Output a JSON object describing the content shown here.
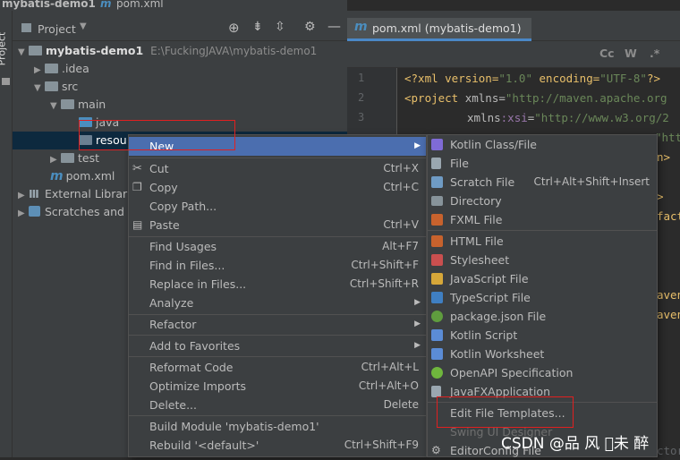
{
  "window": {
    "title": "mybatis-demo1",
    "file_title": "pom.xml"
  },
  "side_strip": {
    "label": "Project"
  },
  "project_panel": {
    "title": "Project",
    "root": {
      "name": "mybatis-demo1",
      "path": "E:\\FuckingJAVA\\mybatis-demo1"
    },
    "items": [
      {
        "label": ".idea"
      },
      {
        "label": "src"
      },
      {
        "label": "main"
      },
      {
        "label": "java"
      },
      {
        "label": "resou"
      },
      {
        "label": "test"
      },
      {
        "label": "pom.xml"
      },
      {
        "label": "External Librar"
      },
      {
        "label": "Scratches and"
      }
    ]
  },
  "editor": {
    "tab_label": "pom.xml (mybatis-demo1)",
    "line_numbers": [
      "1",
      "2",
      "3"
    ],
    "lines": [
      {
        "t1": "<?xml version=",
        "t2": "\"1.0\"",
        "t3": " encoding=",
        "t4": "\"UTF-8\"",
        "t5": "?>"
      },
      {
        "t1": "<project ",
        "t2": "xmlns",
        "t3": "=",
        "t4": "\"http://maven.apache.org"
      },
      {
        "t1": "xmlns",
        "t2": ":xsi",
        "t3": "=",
        "t4": "\"http://www.w3.org/2"
      }
    ],
    "fragments": [
      "n>",
      ">",
      "fact",
      "aven",
      "aven",
      "ctor"
    ],
    "toolbar": [
      "Cc",
      "W",
      ".*"
    ]
  },
  "context_menu": {
    "items": [
      {
        "label": "New",
        "shortcut": ""
      },
      {
        "label": "Cut",
        "shortcut": "Ctrl+X"
      },
      {
        "label": "Copy",
        "shortcut": "Ctrl+C"
      },
      {
        "label": "Copy Path...",
        "shortcut": ""
      },
      {
        "label": "Paste",
        "shortcut": "Ctrl+V"
      },
      {
        "label": "Find Usages",
        "shortcut": "Alt+F7"
      },
      {
        "label": "Find in Files...",
        "shortcut": "Ctrl+Shift+F"
      },
      {
        "label": "Replace in Files...",
        "shortcut": "Ctrl+Shift+R"
      },
      {
        "label": "Analyze",
        "shortcut": ""
      },
      {
        "label": "Refactor",
        "shortcut": ""
      },
      {
        "label": "Add to Favorites",
        "shortcut": ""
      },
      {
        "label": "Reformat Code",
        "shortcut": "Ctrl+Alt+L"
      },
      {
        "label": "Optimize Imports",
        "shortcut": "Ctrl+Alt+O"
      },
      {
        "label": "Delete...",
        "shortcut": "Delete"
      },
      {
        "label": "Build Module 'mybatis-demo1'",
        "shortcut": ""
      },
      {
        "label": "Rebuild '<default>'",
        "shortcut": "Ctrl+Shift+F9"
      }
    ]
  },
  "submenu": {
    "items": [
      {
        "label": "Kotlin Class/File",
        "shortcut": "",
        "color": "#7f6bd6"
      },
      {
        "label": "File",
        "shortcut": "",
        "color": "#9aa7b0"
      },
      {
        "label": "Scratch File",
        "shortcut": "Ctrl+Alt+Shift+Insert",
        "color": "#6f9bc4"
      },
      {
        "label": "Directory",
        "shortcut": "",
        "color": "#87939a"
      },
      {
        "label": "FXML File",
        "shortcut": "",
        "color": "#c7622d"
      },
      {
        "label": "HTML File",
        "shortcut": "",
        "color": "#c7622d"
      },
      {
        "label": "Stylesheet",
        "shortcut": "",
        "color": "#c94f4f"
      },
      {
        "label": "JavaScript File",
        "shortcut": "",
        "color": "#d6a739"
      },
      {
        "label": "TypeScript File",
        "shortcut": "",
        "color": "#3f7fc2"
      },
      {
        "label": "package.json File",
        "shortcut": "",
        "color": "#5f9c3e"
      },
      {
        "label": "Kotlin Script",
        "shortcut": "",
        "color": "#5b8cd6"
      },
      {
        "label": "Kotlin Worksheet",
        "shortcut": "",
        "color": "#5b8cd6"
      },
      {
        "label": "OpenAPI Specification",
        "shortcut": "",
        "color": "#6fb63d"
      },
      {
        "label": "JavaFXApplication",
        "shortcut": "",
        "color": "#9aa7b0"
      },
      {
        "label": "Edit File Templates...",
        "shortcut": "",
        "color": ""
      },
      {
        "label": "Swing UI Designer",
        "shortcut": "",
        "color": ""
      },
      {
        "label": "EditorConfig File",
        "shortcut": "",
        "color": "#9aa7b0"
      }
    ]
  },
  "watermark": "CSDN @品 风 \u0000未 醉"
}
